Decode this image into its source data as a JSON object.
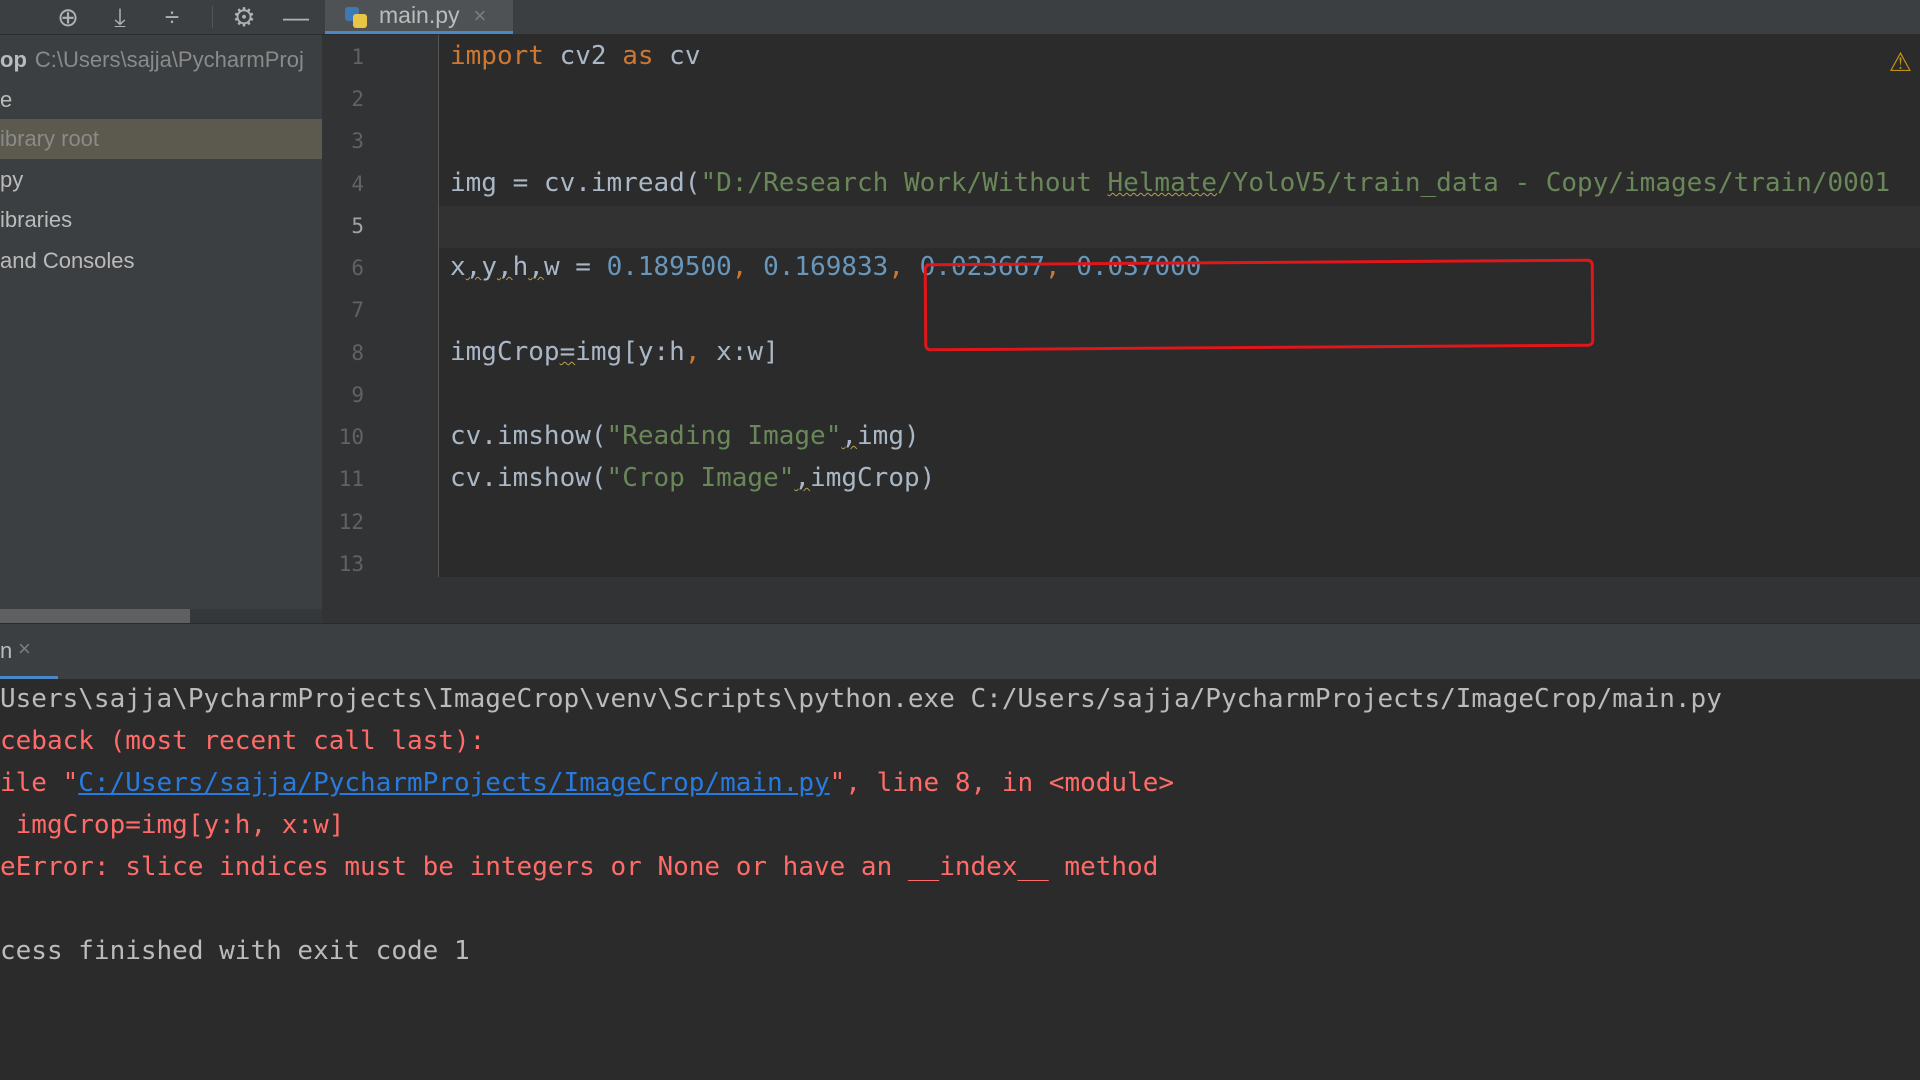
{
  "toolbar": {
    "icons": [
      "crosshair-icon",
      "collapse-icon",
      "expand-icon",
      "gear-icon",
      "minimize-icon"
    ]
  },
  "tab": {
    "label": "main.py",
    "close": "×"
  },
  "sidebar": {
    "rows": [
      {
        "label": "op",
        "path": "C:\\Users\\sajja\\PycharmProj"
      },
      {
        "label": "e"
      },
      {
        "label": "ibrary root",
        "selected": true
      },
      {
        "label": "py"
      },
      {
        "label": "ibraries"
      },
      {
        "label": "and Consoles"
      }
    ]
  },
  "editor": {
    "line_numbers": [
      "1",
      "2",
      "3",
      "4",
      "5",
      "6",
      "7",
      "8",
      "9",
      "10",
      "11",
      "12",
      "13"
    ],
    "current_line": "5",
    "lines": {
      "l1": {
        "kw1": "import",
        "t1": " cv2 ",
        "kw2": "as",
        "t2": " cv"
      },
      "l4": {
        "t1": "img = cv.imread(",
        "s1": "\"D:/Research Work/Without ",
        "s2": "Helmate",
        "s3": "/YoloV5/train_data - Copy/images/train/0001"
      },
      "l6": {
        "v1": "x",
        "c1": ",",
        "v2": "y",
        "c2": ",",
        "v3": "h",
        "c3": ",",
        "v4": "w",
        "eq": " = ",
        "n1": "0.189500",
        "s1": ", ",
        "n2": "0.169833",
        "s2": ", ",
        "n3": "0.023667",
        "s3": ", ",
        "n4": "0.037000"
      },
      "l8": {
        "t1": "imgCrop",
        "eq": "=",
        "t2": "img[y:h",
        "c": ",",
        "t3": " x:w]"
      },
      "l10": {
        "t1": "cv.imshow(",
        "s1": "\"Reading Image\"",
        "c": ",",
        "t2": "img)"
      },
      "l11": {
        "t1": "cv.imshow(",
        "s1": "\"Crop Image\"",
        "c": ",",
        "t2": "imgCrop)"
      }
    },
    "warning": "⚠"
  },
  "run": {
    "tab_label": "n",
    "tab_close": "×",
    "console": {
      "cmd": "Users\\sajja\\PycharmProjects\\ImageCrop\\venv\\Scripts\\python.exe C:/Users/sajja/PycharmProjects/ImageCrop/main.py",
      "trace1": "ceback (most recent call last):",
      "file_pre": "ile \"",
      "file_link": "C:/Users/sajja/PycharmProjects/ImageCrop/main.py",
      "file_post": "\", line 8, in <module>",
      "code": " imgCrop=img[y:h, x:w]",
      "error": "eError: slice indices must be integers or None or have an __index__ method",
      "exit": "cess finished with exit code 1"
    }
  }
}
